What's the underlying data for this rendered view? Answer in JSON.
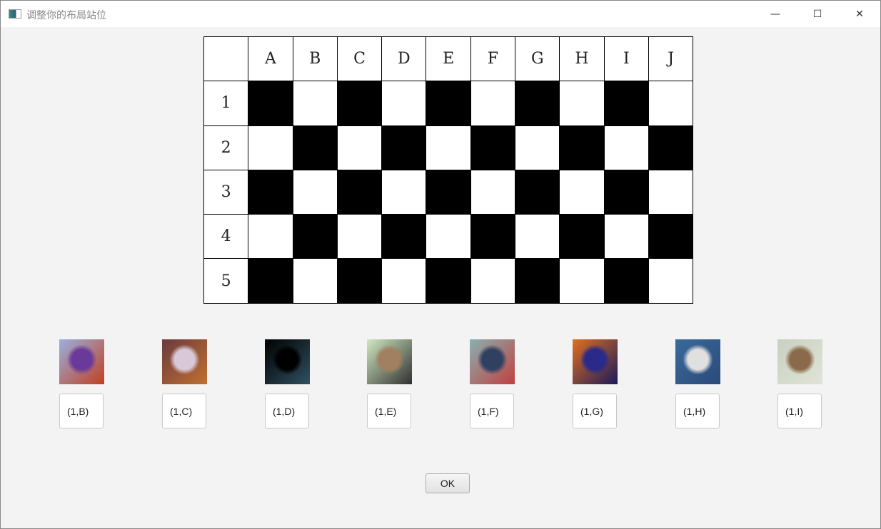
{
  "window": {
    "title": "调整你的布局站位",
    "minimize": "—",
    "maximize": "☐",
    "close": "✕"
  },
  "board": {
    "columns": [
      "A",
      "B",
      "C",
      "D",
      "E",
      "F",
      "G",
      "H",
      "I",
      "J"
    ],
    "rows": [
      "1",
      "2",
      "3",
      "4",
      "5"
    ]
  },
  "pieces": [
    {
      "position": "(1,B)",
      "colors": [
        "#9ab0e0",
        "#6a3a9a",
        "#c04020"
      ]
    },
    {
      "position": "(1,C)",
      "colors": [
        "#6a3a40",
        "#d8c8d8",
        "#c07030"
      ]
    },
    {
      "position": "(1,D)",
      "colors": [
        "#000000",
        "#000000",
        "#305060"
      ]
    },
    {
      "position": "(1,E)",
      "colors": [
        "#d0e8c0",
        "#a08060",
        "#303030"
      ]
    },
    {
      "position": "(1,F)",
      "colors": [
        "#8ab0b0",
        "#304060",
        "#c04040"
      ]
    },
    {
      "position": "(1,G)",
      "colors": [
        "#e07020",
        "#2a2a8a",
        "#1a1a5a"
      ]
    },
    {
      "position": "(1,H)",
      "colors": [
        "#3a6a9a",
        "#e0e0e0",
        "#2a4a7a"
      ]
    },
    {
      "position": "(1,I)",
      "colors": [
        "#c8d0c0",
        "#8a6a4a",
        "#e0e4d8"
      ]
    }
  ],
  "ok_label": "OK"
}
